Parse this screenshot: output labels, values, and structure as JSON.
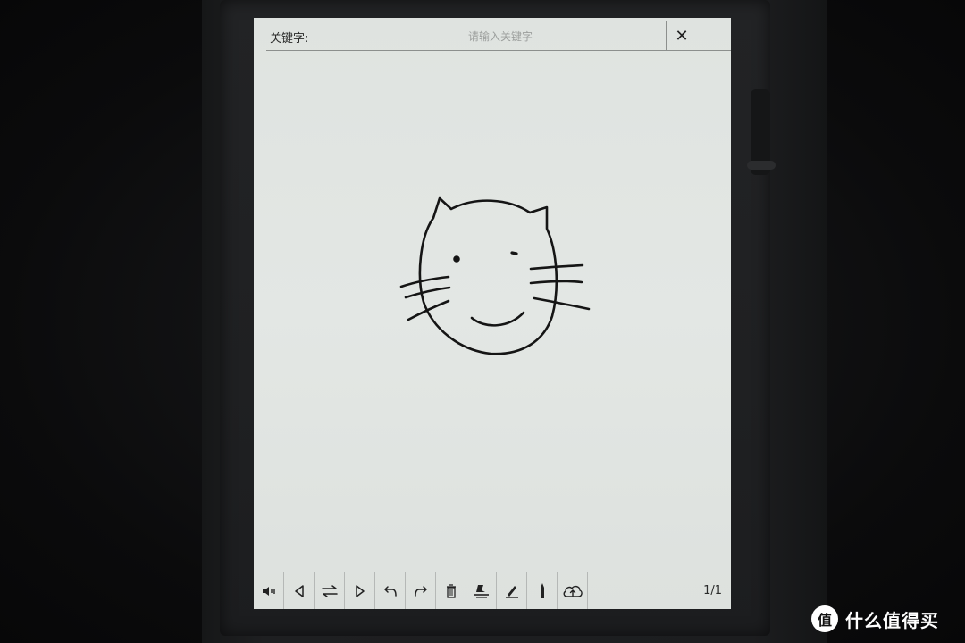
{
  "search": {
    "label": "关键字:",
    "placeholder": "请输入关键字",
    "close_symbol": "✕"
  },
  "toolbar": {
    "tools": [
      {
        "name": "audio-icon"
      },
      {
        "name": "previous-page-icon"
      },
      {
        "name": "switch-page-icon"
      },
      {
        "name": "next-page-icon"
      },
      {
        "name": "undo-icon"
      },
      {
        "name": "redo-icon"
      },
      {
        "name": "trash-icon"
      },
      {
        "name": "eraser-icon"
      },
      {
        "name": "pen-icon"
      },
      {
        "name": "pencil-icon"
      },
      {
        "name": "cloud-upload-icon"
      }
    ],
    "page_indicator": "1/1"
  },
  "watermark": {
    "text": "什么值得买",
    "logo_glyph": "值"
  },
  "colors": {
    "screen": "#e1e5e2",
    "ink": "#151515",
    "device": "#1f2022"
  }
}
